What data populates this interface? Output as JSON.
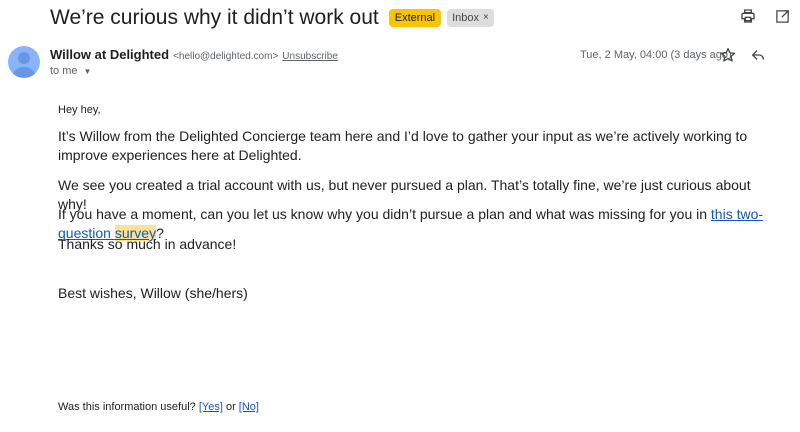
{
  "email": {
    "subject": "We’re curious why it didn’t work out",
    "badges": {
      "external": "External",
      "inbox": "Inbox",
      "inbox_remove": "×"
    },
    "sender": {
      "name": "Willow at Delighted",
      "email": "<hello@delighted.com>",
      "unsubscribe": "Unsubscribe"
    },
    "to": "to me",
    "date": "Tue, 2 May, 04:00 (3 days ago)",
    "body": {
      "greeting": "Hey hey,",
      "p1": "It’s Willow from the Delighted Concierge team here and I’d love to gather your input as we’re actively working to improve experiences here at Delighted.",
      "p2": "We see you created a trial account with us, but never pursued a plan. That’s totally fine, we’re just curious about why!",
      "p3_before": "If you have a moment, can you let us know why you didn’t pursue a plan and what was missing for you in ",
      "p3_link_a": "this two-question ",
      "p3_link_b": "survey",
      "p3_after": "?",
      "p4": "Thanks so much in advance!",
      "signoff": "Best wishes, Willow (she/hers)"
    },
    "footer": {
      "question": "Was this information useful? ",
      "yes": "[Yes]",
      "or": " or ",
      "no": "[No]"
    }
  },
  "icons": [
    "print-icon",
    "open-in-new-icon",
    "star-icon",
    "reply-icon",
    "avatar-icon"
  ],
  "colors": {
    "external_badge": "#f9c400",
    "link": "#1155cc",
    "highlight": "#fde293",
    "avatar": "#8ab4f8"
  }
}
